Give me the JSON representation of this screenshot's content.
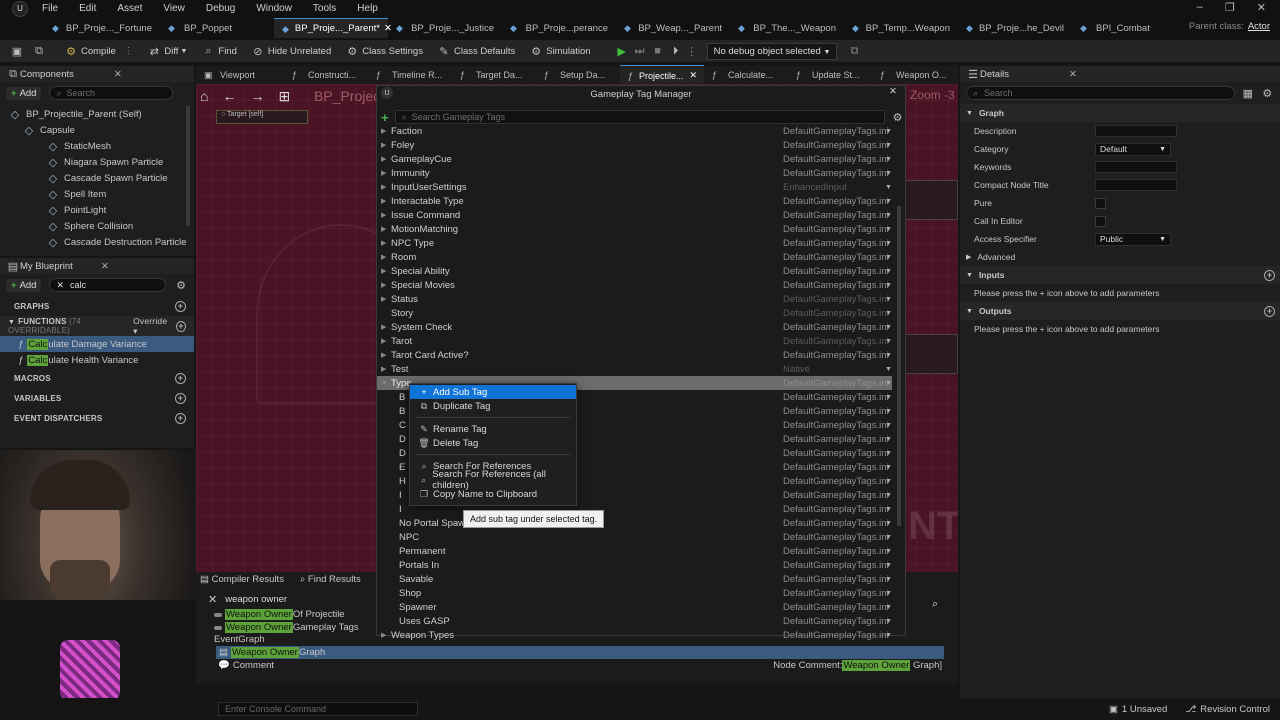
{
  "menubar": {
    "items": [
      "File",
      "Edit",
      "Asset",
      "View",
      "Debug",
      "Window",
      "Tools",
      "Help"
    ]
  },
  "tabs": [
    {
      "label": "BP_Proje..._Fortune"
    },
    {
      "label": "BP_Poppet"
    },
    {
      "label": "BP_Proje..._Parent*"
    },
    {
      "label": "BP_Proje..._Justice"
    },
    {
      "label": "BP_Proje...perance"
    },
    {
      "label": "BP_Weap..._Parent"
    },
    {
      "label": "BP_The..._Weapon"
    },
    {
      "label": "BP_Temp...Weapon"
    },
    {
      "label": "BP_Proje...he_Devil"
    },
    {
      "label": "BPI_Combat"
    }
  ],
  "parent_class": {
    "label": "Parent class:",
    "value": "Actor"
  },
  "toolbar": {
    "compile": "Compile",
    "diff": "Diff",
    "find": "Find",
    "hide_unrelated": "Hide Unrelated",
    "class_settings": "Class Settings",
    "class_defaults": "Class Defaults",
    "simulation": "Simulation",
    "debug_object": "No debug object selected"
  },
  "components": {
    "title": "Components",
    "add": "Add",
    "search_placeholder": "Search",
    "items": [
      {
        "label": "BP_Projectile_Parent (Self)",
        "indent": 0
      },
      {
        "label": "Capsule",
        "indent": 1
      },
      {
        "label": "StaticMesh",
        "indent": 2
      },
      {
        "label": "Niagara Spawn Particle",
        "indent": 2
      },
      {
        "label": "Cascade Spawn Particle",
        "indent": 2
      },
      {
        "label": "Spell Item",
        "indent": 2
      },
      {
        "label": "PointLight",
        "indent": 2
      },
      {
        "label": "Sphere Collision",
        "indent": 2
      },
      {
        "label": "Cascade Destruction Particle",
        "indent": 2
      }
    ]
  },
  "my_blueprint": {
    "title": "My Blueprint",
    "add": "Add",
    "search_value": "calc",
    "graphs": "GRAPHS",
    "functions": "FUNCTIONS",
    "functions_count": "(74 OVERRIDABLE)",
    "override": "Override",
    "function_items": [
      {
        "match": "Calc",
        "rest": "ulate Damage Variance"
      },
      {
        "match": "Calc",
        "rest": "ulate Health Variance"
      }
    ],
    "macros": "MACROS",
    "variables": "VARIABLES",
    "event_dispatchers": "EVENT DISPATCHERS"
  },
  "editor_tabs": [
    "Viewport",
    "Constructi...",
    "Timeline R...",
    "Target Da...",
    "Setup Da...",
    "Projectile...",
    "Calculate...",
    "Update St...",
    "Weapon O..."
  ],
  "graph": {
    "title": "BP_Projec",
    "zoom": "Zoom -3",
    "watermark": "NT"
  },
  "tag_manager": {
    "title": "Gameplay Tag Manager",
    "search_placeholder": "Search Gameplay Tags",
    "rows": [
      {
        "label": "Faction",
        "src": "DefaultGameplayTags.ini",
        "expand": true,
        "child": false,
        "dim": false
      },
      {
        "label": "Foley",
        "src": "DefaultGameplayTags.ini",
        "expand": true,
        "child": false,
        "dim": false
      },
      {
        "label": "GameplayCue",
        "src": "DefaultGameplayTags.ini",
        "expand": true,
        "child": false,
        "dim": false
      },
      {
        "label": "Immunity",
        "src": "DefaultGameplayTags.ini",
        "expand": true,
        "child": false,
        "dim": false
      },
      {
        "label": "InputUserSettings",
        "src": "EnhancedInput",
        "expand": true,
        "child": false,
        "dim": true
      },
      {
        "label": "Interactable Type",
        "src": "DefaultGameplayTags.ini",
        "expand": true,
        "child": false,
        "dim": false
      },
      {
        "label": "Issue Command",
        "src": "DefaultGameplayTags.ini",
        "expand": true,
        "child": false,
        "dim": false
      },
      {
        "label": "MotionMatching",
        "src": "DefaultGameplayTags.ini",
        "expand": true,
        "child": false,
        "dim": false
      },
      {
        "label": "NPC Type",
        "src": "DefaultGameplayTags.ini",
        "expand": true,
        "child": false,
        "dim": false
      },
      {
        "label": "Room",
        "src": "DefaultGameplayTags.ini",
        "expand": true,
        "child": false,
        "dim": false
      },
      {
        "label": "Special Ability",
        "src": "DefaultGameplayTags.ini",
        "expand": true,
        "child": false,
        "dim": false
      },
      {
        "label": "Special Movies",
        "src": "DefaultGameplayTags.ini",
        "expand": true,
        "child": false,
        "dim": false
      },
      {
        "label": "Status",
        "src": "DefaultGameplayTags.ini",
        "expand": true,
        "child": false,
        "dim": true
      },
      {
        "label": "Story",
        "src": "DefaultGameplayTags.ini",
        "expand": false,
        "child": false,
        "dim": true
      },
      {
        "label": "System Check",
        "src": "DefaultGameplayTags.ini",
        "expand": true,
        "child": false,
        "dim": false
      },
      {
        "label": "Tarot",
        "src": "DefaultGameplayTags.ini",
        "expand": true,
        "child": false,
        "dim": true
      },
      {
        "label": "Tarot Card Active?",
        "src": "DefaultGameplayTags.ini",
        "expand": true,
        "child": false,
        "dim": false
      },
      {
        "label": "Test",
        "src": "Native",
        "expand": true,
        "child": false,
        "dim": true
      },
      {
        "label": "Type",
        "src": "DefaultGameplayTags.ini",
        "expand": true,
        "child": false,
        "dim": false,
        "selected": true
      },
      {
        "label": "B",
        "src": "DefaultGameplayTags.ini",
        "expand": false,
        "child": true,
        "dim": false
      },
      {
        "label": "B",
        "src": "DefaultGameplayTags.ini",
        "expand": false,
        "child": true,
        "dim": false
      },
      {
        "label": "C",
        "src": "DefaultGameplayTags.ini",
        "expand": false,
        "child": true,
        "dim": false
      },
      {
        "label": "D",
        "src": "DefaultGameplayTags.ini",
        "expand": false,
        "child": true,
        "dim": false
      },
      {
        "label": "D",
        "src": "DefaultGameplayTags.ini",
        "expand": false,
        "child": true,
        "dim": false
      },
      {
        "label": "E",
        "src": "DefaultGameplayTags.ini",
        "expand": false,
        "child": true,
        "dim": false
      },
      {
        "label": "H",
        "src": "DefaultGameplayTags.ini",
        "expand": false,
        "child": true,
        "dim": false
      },
      {
        "label": "I",
        "src": "DefaultGameplayTags.ini",
        "expand": false,
        "child": true,
        "dim": false
      },
      {
        "label": "I",
        "src": "DefaultGameplayTags.ini",
        "expand": false,
        "child": true,
        "dim": false
      },
      {
        "label": "No Portal Spawn",
        "src": "DefaultGameplayTags.ini",
        "expand": false,
        "child": true,
        "dim": false
      },
      {
        "label": "NPC",
        "src": "DefaultGameplayTags.ini",
        "expand": false,
        "child": true,
        "dim": false
      },
      {
        "label": "Permanent",
        "src": "DefaultGameplayTags.ini",
        "expand": false,
        "child": true,
        "dim": false
      },
      {
        "label": "Portals In",
        "src": "DefaultGameplayTags.ini",
        "expand": false,
        "child": true,
        "dim": false
      },
      {
        "label": "Savable",
        "src": "DefaultGameplayTags.ini",
        "expand": false,
        "child": true,
        "dim": false
      },
      {
        "label": "Shop",
        "src": "DefaultGameplayTags.ini",
        "expand": false,
        "child": true,
        "dim": false
      },
      {
        "label": "Spawner",
        "src": "DefaultGameplayTags.ini",
        "expand": false,
        "child": true,
        "dim": false
      },
      {
        "label": "Uses GASP",
        "src": "DefaultGameplayTags.ini",
        "expand": false,
        "child": true,
        "dim": false
      },
      {
        "label": "Weapon Types",
        "src": "DefaultGameplayTags.ini",
        "expand": true,
        "child": false,
        "dim": false
      }
    ]
  },
  "context_menu": {
    "items": [
      {
        "label": "Add Sub Tag",
        "icon": "plus-icon",
        "highlight": true
      },
      {
        "label": "Duplicate Tag",
        "icon": "duplicate-icon",
        "highlight": false
      },
      {
        "sep": true
      },
      {
        "label": "Rename Tag",
        "icon": "pencil-icon",
        "highlight": false
      },
      {
        "label": "Delete Tag",
        "icon": "trash-icon",
        "highlight": false
      },
      {
        "sep": true
      },
      {
        "label": "Search For References",
        "icon": "search-icon",
        "highlight": false
      },
      {
        "label": "Search For References (all children)",
        "icon": "search-icon",
        "highlight": false
      },
      {
        "label": "Copy Name to Clipboard",
        "icon": "copy-icon",
        "highlight": false
      }
    ],
    "tooltip": "Add sub tag under selected tag."
  },
  "details": {
    "title": "Details",
    "search_placeholder": "Search",
    "graph_section": "Graph",
    "rows": [
      {
        "label": "Description",
        "type": "text",
        "value": ""
      },
      {
        "label": "Category",
        "type": "select",
        "value": "Default"
      },
      {
        "label": "Keywords",
        "type": "text",
        "value": ""
      },
      {
        "label": "Compact Node Title",
        "type": "text",
        "value": ""
      },
      {
        "label": "Pure",
        "type": "check",
        "value": ""
      },
      {
        "label": "Call In Editor",
        "type": "check",
        "value": ""
      },
      {
        "label": "Access Specifier",
        "type": "select",
        "value": "Public"
      }
    ],
    "advanced": "Advanced",
    "inputs": "Inputs",
    "inputs_hint": "Please press the + icon above to add parameters",
    "outputs": "Outputs",
    "outputs_hint": "Please press the + icon above to add parameters"
  },
  "bottom": {
    "compiler_results": "Compiler Results",
    "find_results": "Find Results",
    "search_value": "weapon owner",
    "results": [
      {
        "hl": "Weapon Owner",
        "rest": " Of Projectile"
      },
      {
        "hl": "Weapon Owner",
        "rest": " Gameplay Tags"
      }
    ],
    "event_graph": "EventGraph",
    "graph_result": {
      "hl": "Weapon Owner",
      "rest": " Graph"
    },
    "comment": "Comment",
    "node_comment": {
      "prefix": "Node Comment:",
      "hl": "Weapon Owner",
      "rest": " Graph]"
    }
  },
  "statusbar": {
    "console_placeholder": "Enter Console Command",
    "unsaved": "1 Unsaved",
    "revision": "Revision Control"
  }
}
